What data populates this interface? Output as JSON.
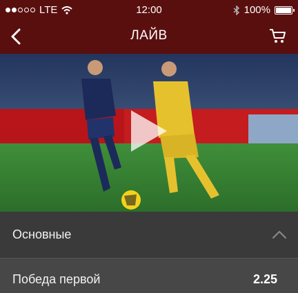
{
  "status_bar": {
    "carrier": "LTE",
    "time": "12:00",
    "battery": "100%"
  },
  "navbar": {
    "title": "ЛАЙВ",
    "icons": {
      "back": "back-arrow-icon",
      "cart": "cart-icon"
    }
  },
  "video": {
    "icon": "play-icon"
  },
  "section": {
    "title": "Основные",
    "icon": "chevron-up-icon"
  },
  "bets": [
    {
      "label": "Победа первой",
      "odds": "2.25"
    }
  ],
  "colors": {
    "header": "#5a0f0f",
    "section_bg": "#3a3a3a",
    "row_bg": "#474747"
  }
}
